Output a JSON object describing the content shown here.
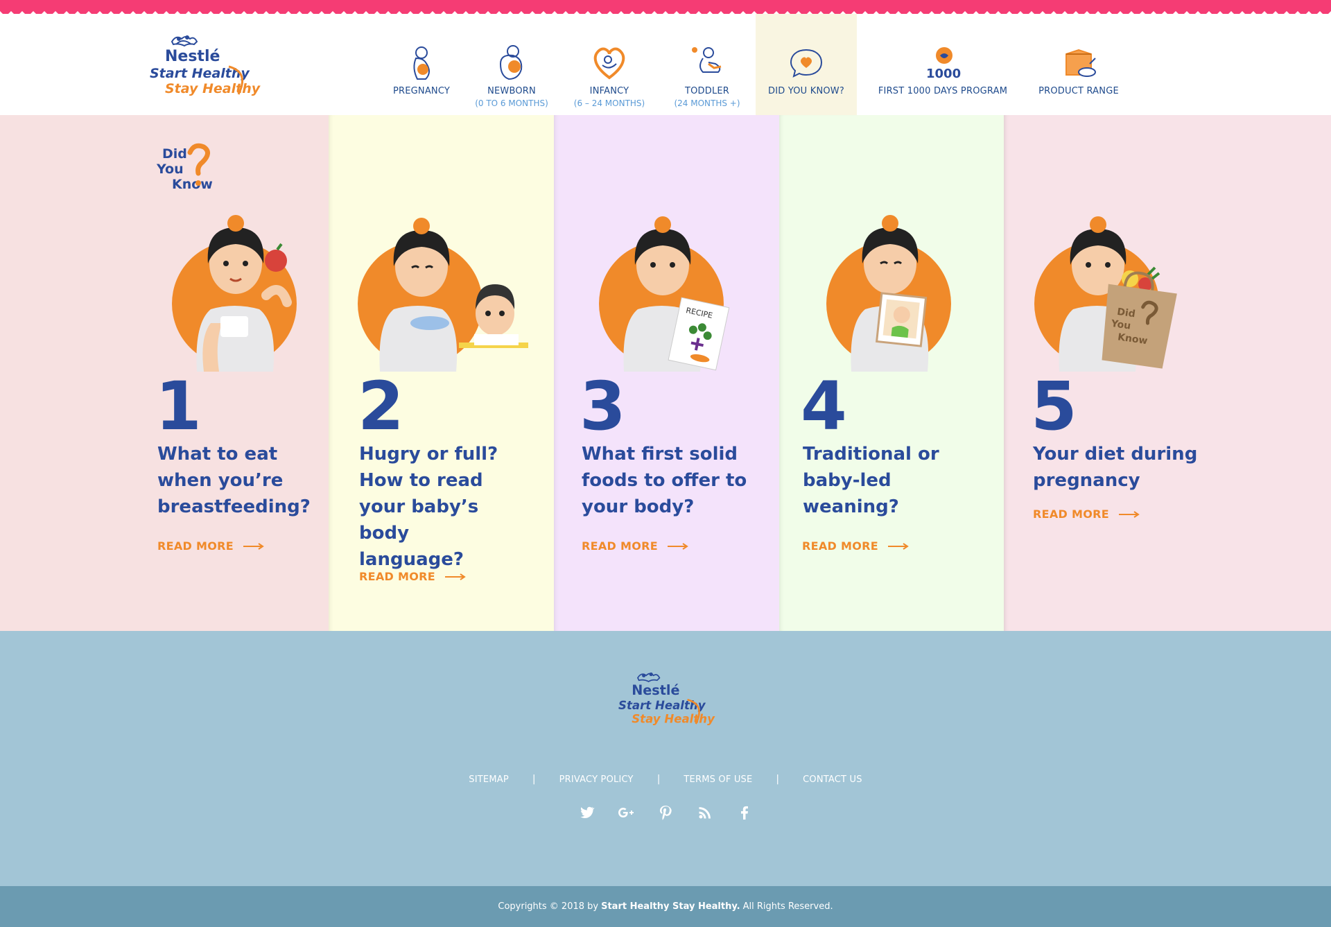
{
  "brand": {
    "name": "Nestlé",
    "line1": "Start Healthy",
    "line2": "Stay Healthy"
  },
  "nav": {
    "items": [
      {
        "label": "PREGNANCY",
        "sub": ""
      },
      {
        "label": "NEWBORN",
        "sub": "(0 TO 6 MONTHS)"
      },
      {
        "label": "INFANCY",
        "sub": "(6 – 24 MONTHS)"
      },
      {
        "label": "TODDLER",
        "sub": "(24 MONTHS +)"
      },
      {
        "label": "DID YOU KNOW?",
        "sub": ""
      },
      {
        "label": "FIRST 1000 DAYS PROGRAM",
        "sub": "",
        "badge": "1000"
      },
      {
        "label": "PRODUCT RANGE",
        "sub": ""
      }
    ]
  },
  "did_you_know": {
    "line1": "Did",
    "line2": "You",
    "line3": "Know"
  },
  "cards": [
    {
      "number": "1",
      "title_lines": [
        "What to eat",
        "when you’re",
        "breastfeeding?"
      ],
      "read_more": "READ MORE",
      "bg": "#f7e1e1"
    },
    {
      "number": "2",
      "title_lines": [
        "Hugry or full?",
        "How to read",
        "your baby’s body",
        "language?"
      ],
      "read_more": "READ MORE",
      "bg": "#fdfde1"
    },
    {
      "number": "3",
      "title_lines": [
        "What first solid",
        "foods to offer to",
        "your body?"
      ],
      "read_more": "READ MORE",
      "bg": "#f4e3fb",
      "recipe": "RECIPE"
    },
    {
      "number": "4",
      "title_lines": [
        "Traditional or",
        "baby-led",
        "weaning?"
      ],
      "read_more": "READ MORE",
      "bg": "#f1fde9"
    },
    {
      "number": "5",
      "title_lines": [
        "Your diet during",
        "pregnancy"
      ],
      "read_more": "READ MORE",
      "bg": "#f8e3e8"
    }
  ],
  "footer": {
    "links": [
      "SITEMAP",
      "PRIVACY POLICY",
      "TERMS OF USE",
      "CONTACT US"
    ],
    "separator": "|",
    "social": [
      "twitter-icon",
      "google-plus-icon",
      "pinterest-icon",
      "rss-icon",
      "facebook-icon"
    ],
    "copyright_pre": "Copyrights © 2018 by",
    "copyright_brand": "Start Healthy Stay Healthy.",
    "copyright_post": "All Rights Reserved."
  },
  "colors": {
    "primary_blue": "#2a4b9b",
    "accent_orange": "#f08a2a",
    "zigzag_pink": "#f53c74",
    "footer_bg": "#a2c5d6",
    "copyright_bg": "#6b9bb1"
  }
}
